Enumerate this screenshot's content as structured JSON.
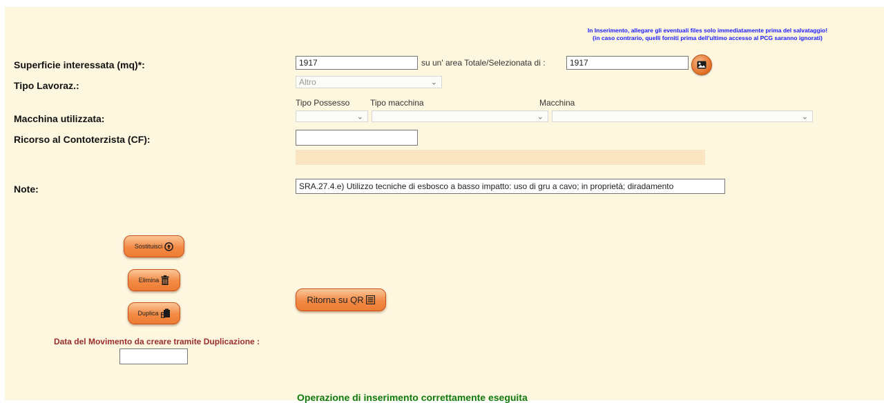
{
  "notice": {
    "line1": "In Inserimento, allegare gli eventuali files solo immediatamente prima del salvataggio!",
    "line2": "(in caso contrario, quelli forniti prima dell'ultimo accesso al PCG saranno ignorati)"
  },
  "superficie": {
    "label": "Superficie interessata (mq)*:",
    "value": "1917",
    "area_label": "su un' area Totale/Selezionata di :",
    "area_value": "1917"
  },
  "tipo_lavoraz": {
    "label": "Tipo Lavoraz.:",
    "selected": "Altro"
  },
  "macchina": {
    "label": "Macchina utilizzata:",
    "col_tipo_possesso": "Tipo Possesso",
    "col_tipo_macchina": "Tipo macchina",
    "col_macchina": "Macchina"
  },
  "contoterzista": {
    "label": "Ricorso al Contoterzista (CF):",
    "value": ""
  },
  "note": {
    "label": "Note:",
    "value": "SRA.27.4.e) Utilizzo tecniche di esbosco a basso impatto: uso di gru a cavo; in proprietà; diradamento"
  },
  "buttons": {
    "sostituisci": "Sostituisci",
    "elimina": "Elimina",
    "duplica": "Duplica",
    "ritorna": "Ritorna su QR"
  },
  "duplicazione": {
    "label": "Data del Movimento da creare tramite Duplicazione :",
    "value": ""
  },
  "status": "Operazione di inserimento correttamente eseguita",
  "icons": {
    "image": "image-icon",
    "upload": "upload-circle-icon",
    "trash": "trash-icon",
    "copy": "copy-icon",
    "list": "list-icon",
    "chevron": "chevron-down-icon"
  }
}
